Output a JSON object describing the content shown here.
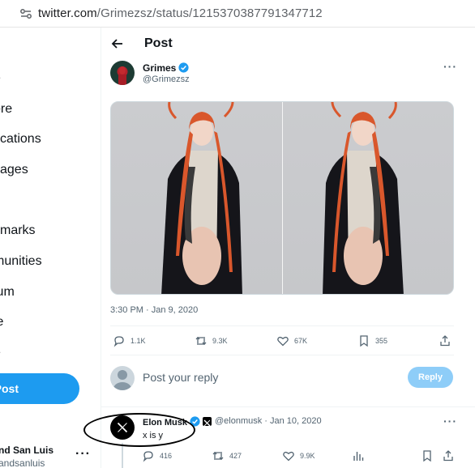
{
  "browser": {
    "url_host": "twitter.com",
    "url_path": "/Grimezsz/status/1215370387791347712"
  },
  "sidebar": {
    "items": [
      {
        "label": "e"
      },
      {
        "label": "ore"
      },
      {
        "label": "fications"
      },
      {
        "label": "sages"
      },
      {
        "label": "kmarks"
      },
      {
        "label": "munities"
      },
      {
        "label": "ium"
      },
      {
        "label": "le"
      },
      {
        "label": "e"
      }
    ],
    "post_label": "Post",
    "account_name": "nd San Luis",
    "account_handle": "andsanluis",
    "more_label": "···"
  },
  "header": {
    "title": "Post"
  },
  "tweet": {
    "author_name": "Grimes",
    "author_handle": "@Grimezsz",
    "more_label": "···",
    "timestamp": "3:30 PM · Jan 9, 2020",
    "actions": {
      "replies": "1.1K",
      "reposts": "9.3K",
      "likes": "67K",
      "bookmarks": "355"
    }
  },
  "reply_box": {
    "placeholder": "Post your reply",
    "button_label": "Reply"
  },
  "reply": {
    "author_name": "Elon Musk",
    "author_handle": "@elonmusk · Jan 10, 2020",
    "text": "x is y",
    "more_label": "···",
    "actions": {
      "replies": "416",
      "reposts": "427",
      "likes": "9.9K"
    }
  },
  "colors": {
    "accent": "#1d9bf0",
    "accent_disabled": "#8ecdf8",
    "muted_text": "#536471"
  }
}
